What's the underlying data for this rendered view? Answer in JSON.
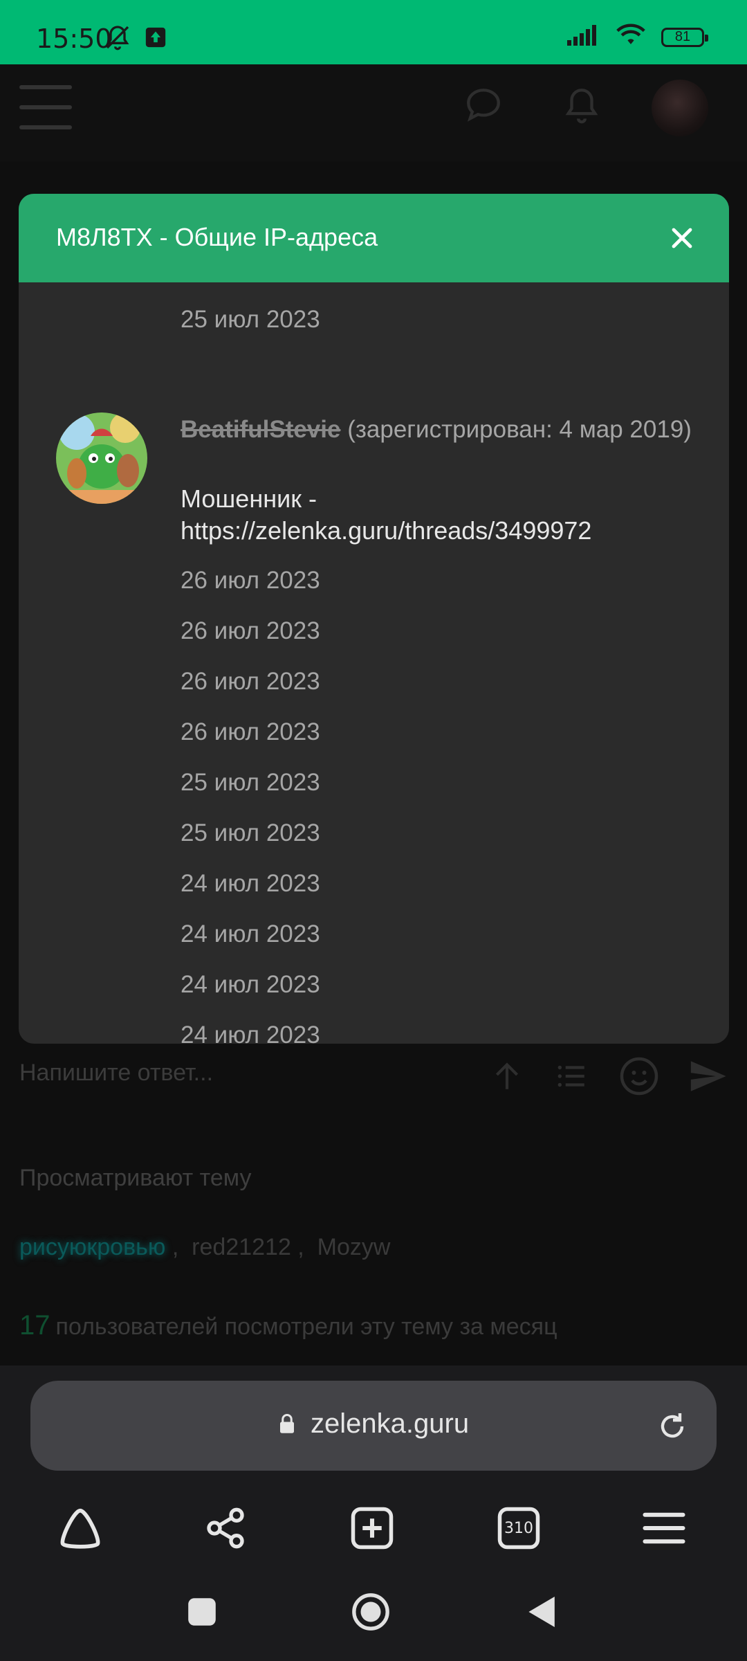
{
  "status_bar": {
    "time": "15:50",
    "battery": "81"
  },
  "modal": {
    "title": "M8Л8TX - Общие IP-адреса",
    "first_date": "25 июл 2023",
    "user": {
      "name": "BeatifulStevie",
      "registered": " (зарегистрирован: 4 мар 2019)",
      "note": "Мошенник - https://zelenka.guru/threads/3499972"
    },
    "dates": [
      "26 июл 2023",
      "26 июл 2023",
      "26 июл 2023",
      "26 июл 2023",
      "25 июл 2023",
      "25 июл 2023",
      "24 июл 2023",
      "24 июл 2023",
      "24 июл 2023",
      "24 июл 2023"
    ]
  },
  "background": {
    "reply_placeholder": "Напишите ответ...",
    "viewing_title": "Просматривают тему",
    "viewers": [
      "рисуюкровью",
      "red21212",
      "Mozyw"
    ],
    "month_count": "17",
    "month_text": "пользователей посмотрели эту тему за месяц"
  },
  "browser": {
    "url": "zelenka.guru",
    "tabs_count": "310"
  }
}
